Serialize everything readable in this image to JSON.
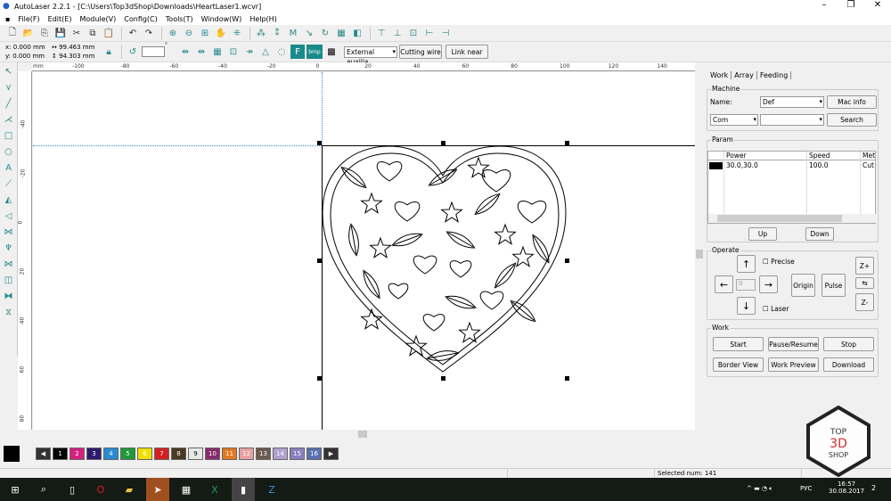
{
  "window": {
    "title": "AutoLaser 2.2.1 - [C:\\Users\\Top3dShop\\Downloads\\HeartLaser1.wcvr]",
    "minimize": "–",
    "maximize": "❐",
    "close": "✕"
  },
  "menu": [
    "File(F)",
    "Edit(E)",
    "Module(V)",
    "Config(C)",
    "Tools(T)",
    "Window(W)",
    "Help(H)"
  ],
  "toolbar1": [
    "new-file",
    "open-file",
    "import",
    "save",
    "cut",
    "copy",
    "paste",
    "undo",
    "redo",
    "zoom-in",
    "zoom-out",
    "zoom-fit",
    "pan-hand",
    "group",
    "ungroup",
    "node-edit",
    "mirror",
    "path",
    "rotate",
    "grid",
    "array",
    "align-top",
    "align-center-v",
    "align-middle",
    "align-left",
    "align-right"
  ],
  "toolbar2": {
    "x": "0.000 mm",
    "y": "0.000 mm",
    "w": "99.463 mm",
    "h": "94.303 mm",
    "angle": "",
    "degree": "°",
    "dropdown": "External auxilia",
    "cutting_wire": "Cutting wire",
    "link_near": "Link near",
    "bmp": "bmp"
  },
  "ruler": {
    "unit": "mm",
    "h_labels": [
      "-100",
      "-80",
      "-60",
      "-40",
      "-20",
      "0",
      "20",
      "40",
      "60",
      "80",
      "100",
      "120",
      "140"
    ],
    "v_labels": [
      "-40",
      "-20",
      "0",
      "20",
      "40",
      "60",
      "80"
    ]
  },
  "toolbox": [
    "select",
    "node",
    "line",
    "polyline",
    "rectangle",
    "ellipse",
    "text",
    "measure",
    "mirror-h",
    "mirror-v",
    "align-1",
    "align-2",
    "align-3",
    "align-4",
    "align-5",
    "align-6"
  ],
  "palette": {
    "current": "#000000",
    "swatches": [
      {
        "n": "1",
        "c": "#000000"
      },
      {
        "n": "2",
        "c": "#d4207f"
      },
      {
        "n": "3",
        "c": "#2c1a6b"
      },
      {
        "n": "4",
        "c": "#2a8ad4"
      },
      {
        "n": "5",
        "c": "#1f9a3a"
      },
      {
        "n": "6",
        "c": "#f0e000"
      },
      {
        "n": "7",
        "c": "#d42020"
      },
      {
        "n": "8",
        "c": "#4a3a20"
      },
      {
        "n": "9",
        "c": "#e8e8e8"
      },
      {
        "n": "10",
        "c": "#8a2a6a"
      },
      {
        "n": "11",
        "c": "#e07a20"
      },
      {
        "n": "12",
        "c": "#e8a0a0"
      },
      {
        "n": "13",
        "c": "#6a5a50"
      },
      {
        "n": "14",
        "c": "#b0a0d0"
      },
      {
        "n": "15",
        "c": "#8a80c0"
      },
      {
        "n": "16",
        "c": "#5a70b0"
      }
    ]
  },
  "status": {
    "selected": "Selected num: 141"
  },
  "panel": {
    "tabs": [
      "Work",
      "Array",
      "Feeding"
    ],
    "machine": {
      "label": "Machine",
      "name_label": "Name:",
      "name_value": "Def",
      "mac_info": "Mac info",
      "port": "Com",
      "port2": "",
      "search": "Search"
    },
    "param": {
      "label": "Param",
      "columns": [
        "Power",
        "Speed",
        "Met"
      ],
      "rows": [
        {
          "color": "#000000",
          "power": "30.0,30.0",
          "speed": "100.0",
          "method": "Cut"
        }
      ],
      "up": "Up",
      "down": "Down"
    },
    "operate": {
      "label": "Operate",
      "precise": "Precise",
      "laser": "Laser",
      "step": "0",
      "origin": "Origin",
      "pulse": "Pulse",
      "zplus": "Z+",
      "zminus": "Z-"
    },
    "work": {
      "label": "Work",
      "start": "Start",
      "pause": "Pause/Resume",
      "stop": "Stop",
      "border_view": "Border View",
      "work_preview": "Work Preview",
      "download": "Download"
    }
  },
  "taskbar": {
    "lang": "РУС",
    "time": "16:57",
    "date": "30.08.2017",
    "notifications": "2"
  },
  "watermark": "TOP 3D SHOP"
}
